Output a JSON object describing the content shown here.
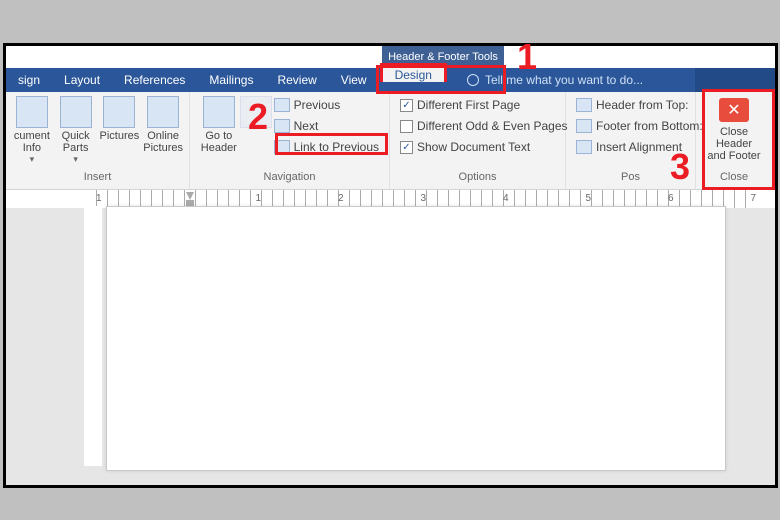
{
  "context_tab": "Header & Footer Tools",
  "tabs": [
    "sign",
    "Layout",
    "References",
    "Mailings",
    "Review",
    "View",
    "Design"
  ],
  "tellme": "Tell me what you want to do...",
  "ribbon": {
    "insert": {
      "label": "Insert",
      "docinfo": "cument\nInfo",
      "quickparts": "Quick\nParts",
      "pictures": "Pictures",
      "online": "Online\nPictures"
    },
    "nav": {
      "label": "Navigation",
      "goto": "Go to\nHeader",
      "prev": "Previous",
      "next": "Next",
      "link": "Link to Previous"
    },
    "options": {
      "label": "Options",
      "first": "Different First Page",
      "odd": "Different Odd & Even Pages",
      "show": "Show Document Text"
    },
    "position": {
      "label": "Pos",
      "top": "Header from Top:",
      "bottom": "Footer from Bottom:",
      "align": "Insert Alignment"
    },
    "close": {
      "label": "Close",
      "btn": "Close Header\nand Footer"
    }
  },
  "ruler_nums": [
    "1",
    "",
    "1",
    "2",
    "3",
    "4",
    "5",
    "6",
    "7"
  ],
  "annotations": {
    "n1": "1",
    "n2": "2",
    "n3": "3"
  }
}
